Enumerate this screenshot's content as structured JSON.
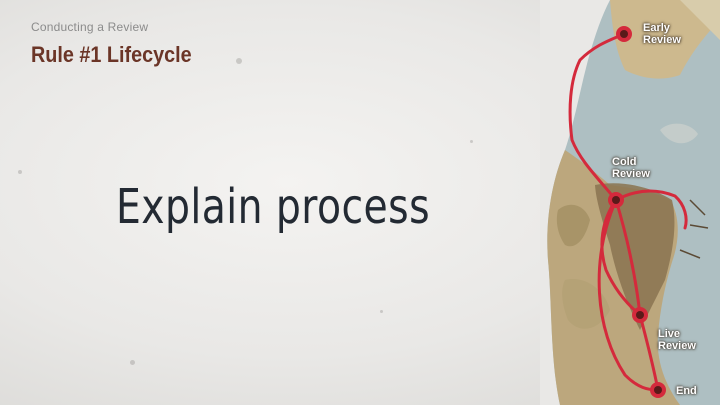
{
  "header": {
    "subtitle": "Conducting a Review",
    "title": "Rule #1 Lifecycle"
  },
  "main": {
    "headline": "Explain process"
  },
  "map": {
    "stops": [
      {
        "label_line1": "Early",
        "label_line2": "Review"
      },
      {
        "label_line1": "Cold",
        "label_line2": "Review"
      },
      {
        "label_line1": "Live",
        "label_line2": "Review"
      },
      {
        "label_line1": "End",
        "label_line2": ""
      }
    ]
  },
  "colors": {
    "title": "#6b3527",
    "headline": "#232a33",
    "route": "#d42a3c",
    "sea": "#aebfc2",
    "land": "#cdb98e"
  }
}
